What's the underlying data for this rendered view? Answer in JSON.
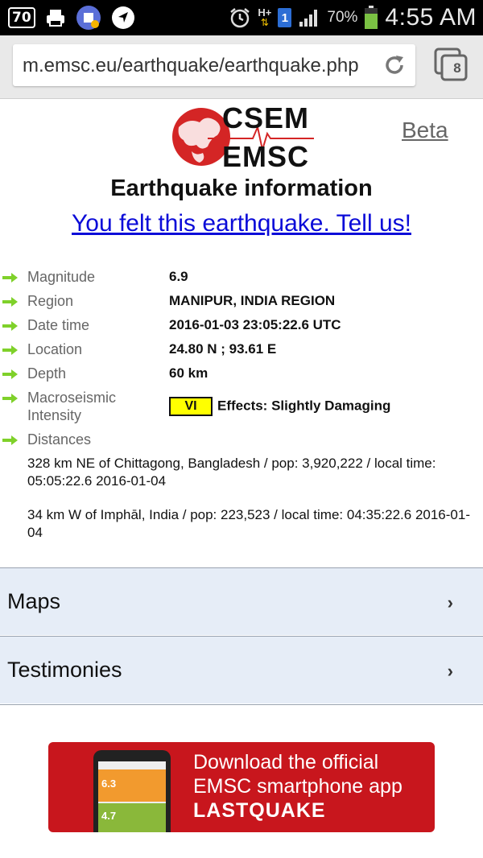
{
  "status_bar": {
    "badge": "70",
    "network": "H+",
    "sim": "1",
    "battery_pct": "70%",
    "time": "4:55 AM"
  },
  "browser": {
    "url": "m.emsc.eu/earthquake/earthquake.php",
    "tab_count": "8"
  },
  "header": {
    "logo_top": "CSEM",
    "logo_bottom": "EMSC",
    "beta_link": "Beta",
    "title": "Earthquake information",
    "felt_link": "You felt this earthquake. Tell us!"
  },
  "details": {
    "magnitude_label": "Magnitude",
    "magnitude": "6.9",
    "region_label": "Region",
    "region": "MANIPUR, INDIA REGION",
    "datetime_label": "Date time",
    "datetime": "2016-01-03 23:05:22.6 UTC",
    "location_label": "Location",
    "location": "24.80 N ; 93.61 E",
    "depth_label": "Depth",
    "depth": "60 km",
    "intensity_label": "Macroseismic Intensity",
    "intensity_value": "VI",
    "intensity_effects": "Effects: Slightly Damaging",
    "distances_label": "Distances",
    "distances": [
      "328 km NE of Chittagong, Bangladesh / pop: 3,920,222 / local time: 05:05:22.6 2016-01-04",
      "34 km W of Imphāl, India / pop: 223,523 / local time: 04:35:22.6 2016-01-04"
    ]
  },
  "sections": [
    {
      "label": "Maps",
      "chevron": "›"
    },
    {
      "label": "Testimonies",
      "chevron": "›"
    }
  ],
  "banner": {
    "line1": "Download the official",
    "line2": "EMSC smartphone app",
    "line3": "LASTQUAKE",
    "phone_mag1": "6.3",
    "phone_mag2": "4.7"
  },
  "colors": {
    "link": "#0b0bd8",
    "arrow": "#7fd12a",
    "logo_red": "#d42525",
    "intensity_bg": "#ffff00",
    "nav_bg": "#e6edf7",
    "banner_red": "#c8161d"
  }
}
